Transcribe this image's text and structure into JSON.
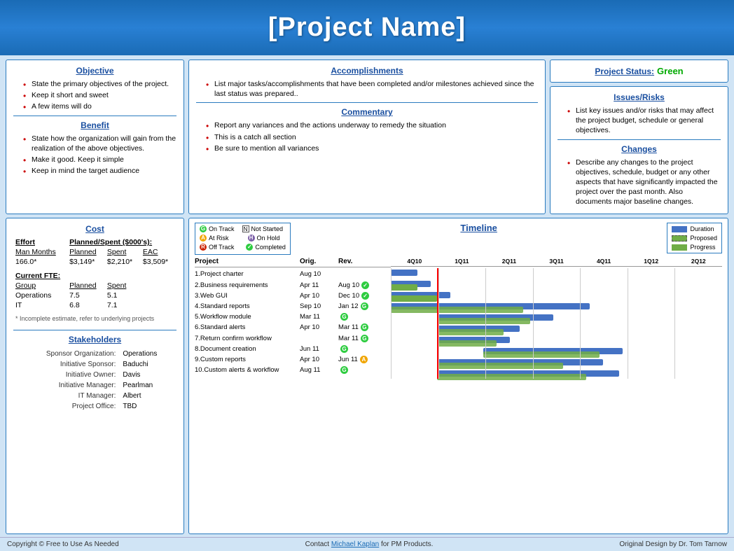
{
  "header": {
    "title": "[Project Name]"
  },
  "objective": {
    "title": "Objective",
    "items": [
      "State the primary objectives of the project.",
      "Keep it short and sweet",
      "A few items will do"
    ]
  },
  "benefit": {
    "title": "Benefit",
    "items": [
      "State how the organization will gain from the realization of the above objectives.",
      "Make it good. Keep it simple",
      "Keep in mind the target audience"
    ]
  },
  "accomplishments": {
    "title": "Accomplishments",
    "items": [
      "List major tasks/accomplishments that have been completed and/or milestones achieved  since the last status was prepared.."
    ]
  },
  "commentary": {
    "title": "Commentary",
    "items": [
      "Report any variances  and the actions underway to remedy the situation",
      "This is a catch all section",
      "Be  sure to mention all variances"
    ]
  },
  "project_status": {
    "label": "Project Status:",
    "value": "Green"
  },
  "issues_risks": {
    "title": "Issues/Risks",
    "items": [
      "List key issues and/or risks that may affect the project budget, schedule or general objectives."
    ]
  },
  "changes": {
    "title": "Changes",
    "items": [
      "Describe any changes to the project objectives, schedule, budget or any other aspects that have significantly impacted the project over the past month. Also documents major baseline changes."
    ]
  },
  "cost": {
    "title": "Cost",
    "effort_label": "Effort",
    "planned_spent_label": "Planned/Spent ($000's):",
    "columns": [
      "Man Months",
      "Planned",
      "Spent",
      "EAC"
    ],
    "row": [
      "166.0*",
      "$3,149*",
      "$2,210*",
      "$3,509*"
    ],
    "current_fte_label": "Current FTE:",
    "fte_columns": [
      "Group",
      "Planned",
      "Spent"
    ],
    "fte_rows": [
      [
        "Operations",
        "7.5",
        "5.1"
      ],
      [
        "IT",
        "6.8",
        "7.1"
      ]
    ],
    "footnote": "* Incomplete estimate, refer to underlying projects"
  },
  "stakeholders": {
    "title": "Stakeholders",
    "rows": [
      [
        "Sponsor Organization:",
        "Operations"
      ],
      [
        "Initiative Sponsor:",
        "Baduchi"
      ],
      [
        "Initiative Owner:",
        "Davis"
      ],
      [
        "Initiative Manager:",
        "Pearlman"
      ],
      [
        "IT Manager:",
        "Albert"
      ],
      [
        "Project Office:",
        "TBD"
      ]
    ]
  },
  "timeline": {
    "title": "Timeline",
    "legend_status": [
      {
        "label": "On Track",
        "color": "green",
        "symbol": "G"
      },
      {
        "label": "At Risk",
        "color": "yellow",
        "symbol": "A"
      },
      {
        "label": "Off Track",
        "color": "red",
        "symbol": "R"
      },
      {
        "label": "Not Started",
        "color": "gray",
        "symbol": "N"
      },
      {
        "label": "On Hold",
        "color": "purple",
        "symbol": "H"
      },
      {
        "label": "Completed",
        "color": "green",
        "symbol": "C"
      }
    ],
    "legend_bars": [
      {
        "label": "Duration",
        "type": "duration"
      },
      {
        "label": "Proposed",
        "type": "proposed"
      },
      {
        "label": "Progress",
        "type": "progress"
      }
    ],
    "quarters": [
      "4Q10",
      "1Q11",
      "2Q11",
      "3Q11",
      "4Q11",
      "1Q12",
      "2Q12"
    ],
    "projects": [
      {
        "name": "1.Project charter",
        "orig": "Aug 10",
        "rev": "",
        "status": ""
      },
      {
        "name": "2.Business requirements",
        "orig": "Apr 11",
        "rev": "Aug 10",
        "status": "C"
      },
      {
        "name": "3.Web GUI",
        "orig": "Apr 10",
        "rev": "Dec 10",
        "status": "C"
      },
      {
        "name": "4.Standard reports",
        "orig": "Sep 10",
        "rev": "Jan 12",
        "status": "G"
      },
      {
        "name": "5.Workflow module",
        "orig": "Mar 11",
        "rev": "",
        "status": "G"
      },
      {
        "name": "6.Standard alerts",
        "orig": "Apr 10",
        "rev": "Mar 11",
        "status": "G"
      },
      {
        "name": "7.Return confirm workflow",
        "orig": "",
        "rev": "Mar 11",
        "status": "G"
      },
      {
        "name": "8.Document creation",
        "orig": "Jun 11",
        "rev": "",
        "status": "G"
      },
      {
        "name": "9.Custom reports",
        "orig": "Apr 10",
        "rev": "Jun 11",
        "status": "A"
      },
      {
        "name": "10.Custom alerts & workflow",
        "orig": "Aug 11",
        "rev": "",
        "status": "G"
      }
    ]
  },
  "footer": {
    "copyright": "Copyright © Free to  Use As Needed",
    "contact_pre": "Contact ",
    "contact_link": "Michael Kaplan",
    "contact_post": " for PM Products.",
    "attribution": "Original Design by Dr. Tom Tarnow"
  }
}
